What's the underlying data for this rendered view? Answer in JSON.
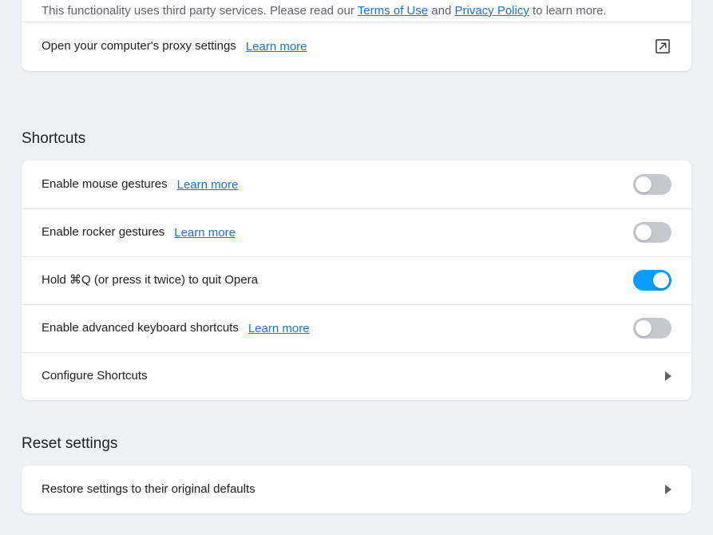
{
  "proxy_card": {
    "description": {
      "text_before_terms": "This functionality uses third party services. Please read our ",
      "terms_link": "Terms of Use",
      "text_between": " and ",
      "privacy_link": "Privacy Policy",
      "text_after": " to learn more."
    },
    "proxy_row": {
      "label": "Open your computer's proxy settings",
      "link": "Learn more",
      "icon": "external-link-icon"
    }
  },
  "shortcuts": {
    "title": "Shortcuts",
    "rows": [
      {
        "label": "Enable mouse gestures",
        "link": "Learn more",
        "control": "toggle",
        "state": "off"
      },
      {
        "label": "Enable rocker gestures",
        "link": "Learn more",
        "control": "toggle",
        "state": "off"
      },
      {
        "label": "Hold ⌘Q (or press it twice) to quit Opera",
        "link": "",
        "control": "toggle",
        "state": "on"
      },
      {
        "label": "Enable advanced keyboard shortcuts",
        "link": "Learn more",
        "control": "toggle",
        "state": "off"
      },
      {
        "label": "Configure Shortcuts",
        "link": "",
        "control": "chevron",
        "state": ""
      }
    ]
  },
  "reset": {
    "title": "Reset settings",
    "rows": [
      {
        "label": "Restore settings to their original defaults",
        "link": "",
        "control": "chevron",
        "state": ""
      }
    ]
  },
  "colors": {
    "page_background": "#eef1f5",
    "card_background": "#ffffff",
    "link": "#1a73c8",
    "label_text": "#202124",
    "description_text": "#5f6368",
    "divider": "#e4e8ee",
    "toggle_on": "#0d9bff",
    "toggle_off": "#c5c8cd"
  }
}
